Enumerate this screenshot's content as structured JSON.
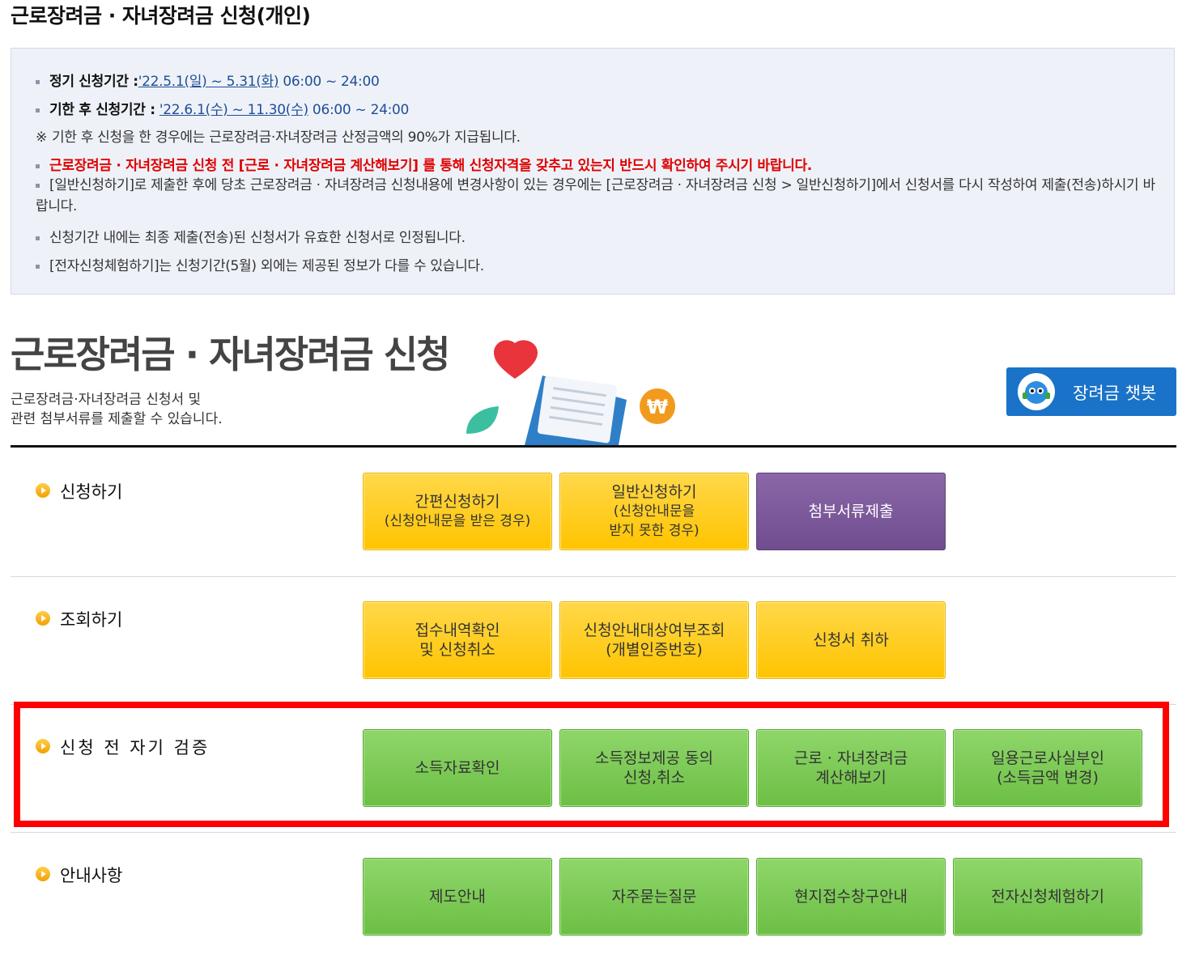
{
  "page": {
    "title": "근로장려금 · 자녀장려금 신청(개인)"
  },
  "notice": {
    "regular_label": "정기 신청기간 :",
    "regular_period": "'22.5.1(일) ~ 5.31(화)",
    "regular_time": " 06:00 ~ 24:00",
    "late_label": "기한 후 신청기간 :",
    "late_period": "'22.6.1(수) ~ 11.30(수)",
    "late_time": " 06:00 ~ 24:00",
    "late_note_mark": "※",
    "late_note": "기한 후 신청을 한 경우에는 근로장려금·자녀장려금 산정금액의 90%가 지급됩니다.",
    "warning": "근로장려금 · 자녀장려금 신청 전 [근로 · 자녀장려금 계산해보기] 를 통해 신청자격을 갖추고 있는지 반드시 확인하여 주시기 바랍니다.",
    "general_submit": "[일반신청하기]로 제출한 후에 당초 근로장려금 · 자녀장려금 신청내용에 변경사항이 있는 경우에는  [근로장려금 · 자녀장려금 신청 > 일반신청하기]에서  신청서를 다시 작성하여 제출(전송)하시기 바랍니다.",
    "final_valid": "신청기간 내에는 최종 제출(전송)된 신청서가 유효한 신청서로 인정됩니다.",
    "experience_note": "[전자신청체험하기]는 신청기간(5월) 외에는 제공된 정보가 다를 수 있습니다."
  },
  "hero": {
    "title": "근로장려금 · 자녀장려금 신청",
    "subtitle_line1": "근로장려금·자녀장려금 신청서 및",
    "subtitle_line2": "관련 첨부서류를 제출할 수 있습니다.",
    "chatbot_label": "장려금 챗봇"
  },
  "sections": {
    "apply": {
      "label": "신청하기",
      "simple_line1": "간편신청하기",
      "simple_line2": "(신청안내문을 받은 경우)",
      "general_line1": "일반신청하기",
      "general_line2": "(신청안내문을",
      "general_line3": "받지 못한 경우)",
      "attach": "첨부서류제출"
    },
    "inquiry": {
      "label": "조회하기",
      "receipt_line1": "접수내역확인",
      "receipt_line2": "및 신청취소",
      "target_line1": "신청안내대상여부조회",
      "target_line2": "(개별인증번호)",
      "withdraw": "신청서 취하"
    },
    "selfcheck": {
      "label": "신청 전 자기 검증",
      "income": "소득자료확인",
      "consent_line1": "소득정보제공 동의",
      "consent_line2": "신청,취소",
      "calc_line1": "근로 · 자녀장려금",
      "calc_line2": "계산해보기",
      "daily_line1": "일용근로사실부인",
      "daily_line2": "(소득금액 변경)"
    },
    "info": {
      "label": "안내사항",
      "system": "제도안내",
      "faq": "자주묻는질문",
      "office": "현지접수창구안내",
      "experience": "전자신청체험하기"
    }
  },
  "colors": {
    "yellow_button": "#ffc400",
    "purple_button": "#6f4d8e",
    "green_button": "#6cbf45",
    "highlight": "#ff0000",
    "chatbot": "#1a73c8",
    "warning_text": "#e00000"
  }
}
